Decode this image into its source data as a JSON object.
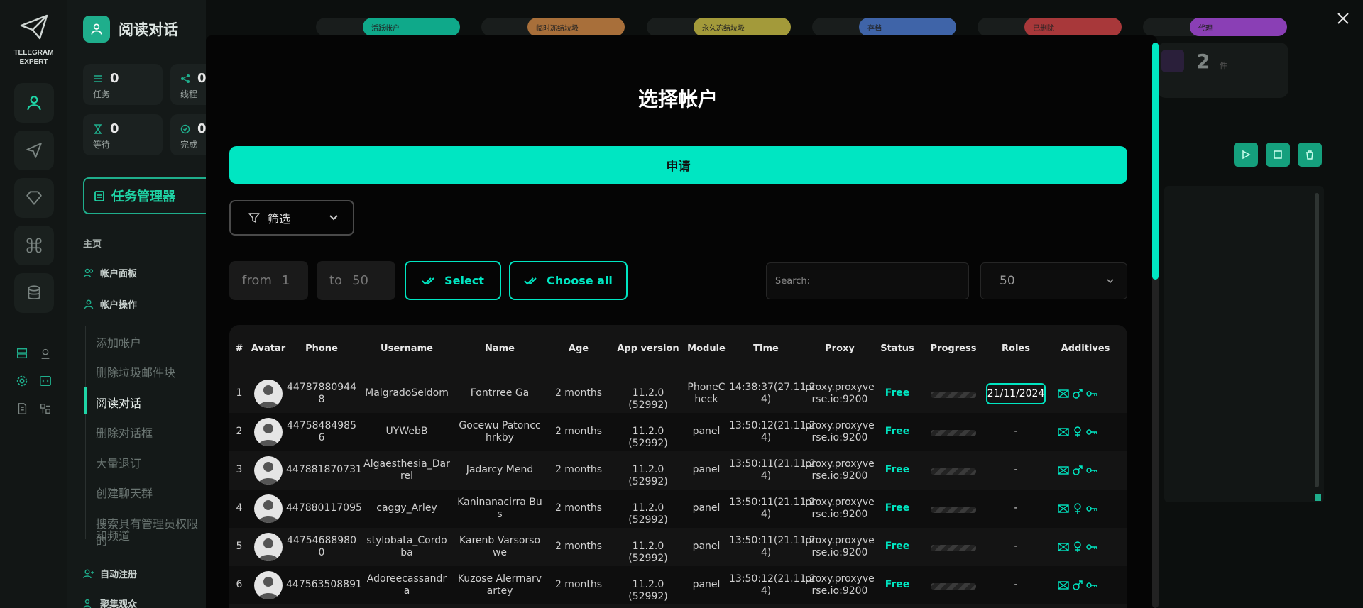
{
  "app": {
    "logo_line1": "TELEGRAM",
    "logo_line2": "EXPERT"
  },
  "sidebar": {
    "title": "阅读对话",
    "stats": [
      {
        "value": "0",
        "label": "任务"
      },
      {
        "value": "0",
        "label": "线程"
      },
      {
        "value": "0",
        "label": "等待"
      },
      {
        "value": "0",
        "label": "完成"
      }
    ],
    "task_manager": "任务管理器",
    "section_main": "主页",
    "links": [
      {
        "label": "帐户面板"
      },
      {
        "label": "帐户操作"
      }
    ],
    "sub_items": [
      "添加帐户",
      "删除垃圾邮件块",
      "阅读对话",
      "删除对话框",
      "大量退订",
      "创建聊天群",
      "搜索具有管理员权限的",
      "和频道"
    ],
    "bottom_links": [
      "自动注册",
      "聚集观众"
    ]
  },
  "background_tabs": [
    {
      "label": "活跃帐户",
      "color": "#0fa98a"
    },
    {
      "label": "临时冻结垃圾",
      "color": "#a86f3a"
    },
    {
      "label": "永久冻结垃圾",
      "color": "#a39a3a"
    },
    {
      "label": "存档",
      "color": "#3f64a8"
    },
    {
      "label": "已删除",
      "color": "#a8383a"
    },
    {
      "label": "代理",
      "color": "#8a3fb5"
    }
  ],
  "background_right": {
    "count": "2",
    "unit": "件"
  },
  "modal": {
    "title": "选择帐户",
    "apply_label": "申请",
    "filter_label": "筛选",
    "range": {
      "from_label": "from",
      "from_value": "1",
      "to_label": "to",
      "to_value": "50"
    },
    "select_label": "Select",
    "choose_all_label": "Choose all",
    "search_placeholder": "Search:",
    "per_page": "50"
  },
  "table": {
    "headers": [
      "#",
      "Avatar",
      "Phone",
      "Username",
      "Name",
      "Age",
      "App version",
      "Module",
      "Time",
      "Proxy",
      "Status",
      "Progress",
      "Roles",
      "Additives"
    ],
    "rows": [
      {
        "n": "1",
        "phone": [
          "44787880944",
          "8"
        ],
        "username": [
          "MalgradoSeldom",
          ""
        ],
        "name": [
          "Fontrree Ga",
          ""
        ],
        "age": "2 months",
        "app": "11.2.0 (52992)",
        "module": [
          "PhoneC",
          "heck"
        ],
        "time": [
          "14:38:37(27.11.2",
          "4)"
        ],
        "proxy": [
          "proxy.proxyve",
          "rse.io:9200"
        ],
        "status": "Free",
        "role": "21/11/2024",
        "gender": "male"
      },
      {
        "n": "2",
        "phone": [
          "44758484985",
          "6"
        ],
        "username": [
          "UYWebB",
          ""
        ],
        "name": [
          "Gocewu Patoncc",
          "hrkby"
        ],
        "age": "2 months",
        "app": "11.2.0 (52992)",
        "module": [
          "panel",
          ""
        ],
        "time": [
          "13:50:12(21.11.2",
          "4)"
        ],
        "proxy": [
          "proxy.proxyve",
          "rse.io:9200"
        ],
        "status": "Free",
        "role": "-",
        "gender": "female"
      },
      {
        "n": "3",
        "phone": [
          "447881870731",
          ""
        ],
        "username": [
          "Algaesthesia_Dar",
          "rel"
        ],
        "name": [
          "Jadarcy Mend",
          ""
        ],
        "age": "2 months",
        "app": "11.2.0 (52992)",
        "module": [
          "panel",
          ""
        ],
        "time": [
          "13:50:11(21.11.2",
          "4)"
        ],
        "proxy": [
          "proxy.proxyve",
          "rse.io:9200"
        ],
        "status": "Free",
        "role": "-",
        "gender": "male"
      },
      {
        "n": "4",
        "phone": [
          "447880117095",
          ""
        ],
        "username": [
          "caggy_Arley",
          ""
        ],
        "name": [
          "Kaninanacirra Bu",
          "s"
        ],
        "age": "2 months",
        "app": "11.2.0 (52992)",
        "module": [
          "panel",
          ""
        ],
        "time": [
          "13:50:11(21.11.2",
          "4)"
        ],
        "proxy": [
          "proxy.proxyve",
          "rse.io:9200"
        ],
        "status": "Free",
        "role": "-",
        "gender": "female"
      },
      {
        "n": "5",
        "phone": [
          "44754688980",
          "0"
        ],
        "username": [
          "stylobata_Cordo",
          "ba"
        ],
        "name": [
          "Karenb Varsorso",
          "we"
        ],
        "age": "2 months",
        "app": "11.2.0 (52992)",
        "module": [
          "panel",
          ""
        ],
        "time": [
          "13:50:11(21.11.2",
          "4)"
        ],
        "proxy": [
          "proxy.proxyve",
          "rse.io:9200"
        ],
        "status": "Free",
        "role": "-",
        "gender": "female"
      },
      {
        "n": "6",
        "phone": [
          "447563508891",
          ""
        ],
        "username": [
          "Adoreecassandr",
          "a"
        ],
        "name": [
          "Kuzose Alerrnarv",
          "artey"
        ],
        "age": "2 months",
        "app": "11.2.0 (52992)",
        "module": [
          "panel",
          ""
        ],
        "time": [
          "13:50:12(21.11.2",
          "4)"
        ],
        "proxy": [
          "proxy.proxyve",
          "rse.io:9200"
        ],
        "status": "Free",
        "role": "-",
        "gender": "male"
      }
    ]
  },
  "colors": {
    "accent": "#00e6c2",
    "sidebar_accent": "#1fae8c"
  }
}
